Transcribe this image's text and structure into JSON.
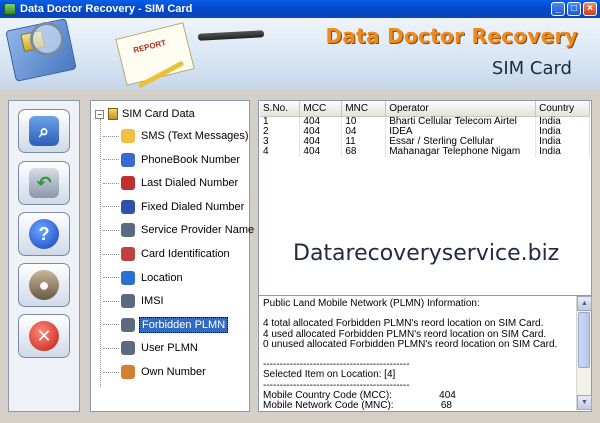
{
  "window": {
    "title": "Data Doctor Recovery - SIM Card"
  },
  "banner": {
    "brand": "Data Doctor Recovery",
    "subtitle": "SIM Card",
    "report_label": "REPORT"
  },
  "tree": {
    "root": "SIM Card Data",
    "items": [
      {
        "label": "SMS (Text Messages)",
        "icon": "sms-icon",
        "color": "#f0c040"
      },
      {
        "label": "PhoneBook Number",
        "icon": "phonebook-icon",
        "color": "#3a6ad0"
      },
      {
        "label": "Last Dialed Number",
        "icon": "last-dialed-icon",
        "color": "#c03030"
      },
      {
        "label": "Fixed Dialed Number",
        "icon": "fixed-dialed-icon",
        "color": "#3050b0"
      },
      {
        "label": "Service Provider Name",
        "icon": "antenna-icon",
        "color": "#5a6a80"
      },
      {
        "label": "Card Identification",
        "icon": "card-icon",
        "color": "#c04040"
      },
      {
        "label": "Location",
        "icon": "globe-icon",
        "color": "#2a70d0"
      },
      {
        "label": "IMSI",
        "icon": "antenna-icon",
        "color": "#5a6a80"
      },
      {
        "label": "Forbidden PLMN",
        "icon": "antenna-icon",
        "color": "#5a6a80",
        "selected": true
      },
      {
        "label": "User PLMN",
        "icon": "antenna-icon",
        "color": "#5a6a80"
      },
      {
        "label": "Own Number",
        "icon": "own-number-icon",
        "color": "#d08030"
      }
    ]
  },
  "grid": {
    "columns": [
      "S.No.",
      "MCC",
      "MNC",
      "Operator",
      "Country"
    ],
    "rows": [
      [
        "1",
        "404",
        "10",
        "Bharti Cellular Telecom Airtel",
        "India"
      ],
      [
        "2",
        "404",
        "04",
        "IDEA",
        "India"
      ],
      [
        "3",
        "404",
        "11",
        "Essar / Sterling Cellular",
        "India"
      ],
      [
        "4",
        "404",
        "68",
        "Mahanagar Telephone Nigam",
        "India"
      ]
    ]
  },
  "watermark": "Datarecoveryservice.biz",
  "info": {
    "lines": [
      "Public Land Mobile Network (PLMN) Information:",
      "",
      "4 total allocated Forbidden PLMN's reord location on SIM Card.",
      "4 used allocated Forbidden PLMN's reord location on SIM Card.",
      "0 unused allocated Forbidden PLMN's reord location on SIM Card.",
      "",
      "--------------------------------------------",
      "Selected Item on Location: [4]",
      "--------------------------------------------",
      "Mobile Country Code (MCC):                 404",
      "Mobile Network Code (MNC):                 68"
    ]
  }
}
